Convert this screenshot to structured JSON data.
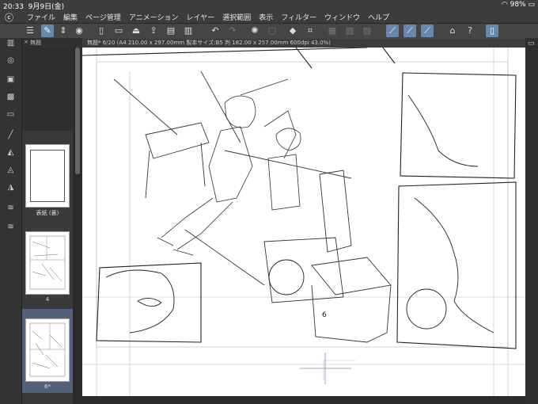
{
  "status": {
    "time": "20:33",
    "date": "9月9日(金)",
    "battery": "98%"
  },
  "menu": [
    "ファイル",
    "編集",
    "ページ管理",
    "アニメーション",
    "レイヤー",
    "選択範囲",
    "表示",
    "フィルター",
    "ウィンドウ",
    "ヘルプ"
  ],
  "tab": {
    "layer_name": "無題"
  },
  "document": {
    "title": "無題* 6/20 (A4 210.00 x 297.00mm 製本サイズ:B5 判 182.00 x 257.00mm 600dpi 43.0%)"
  },
  "pages": [
    {
      "label": "表紙 (裏)"
    },
    {
      "label": "4"
    },
    {
      "label": "6*"
    }
  ],
  "canvas": {
    "panel_number": "6"
  },
  "icons": {
    "app_logo": "clip-studio-icon",
    "menu": "hamburger-icon",
    "undo": "undo-icon",
    "redo": "redo-icon"
  }
}
